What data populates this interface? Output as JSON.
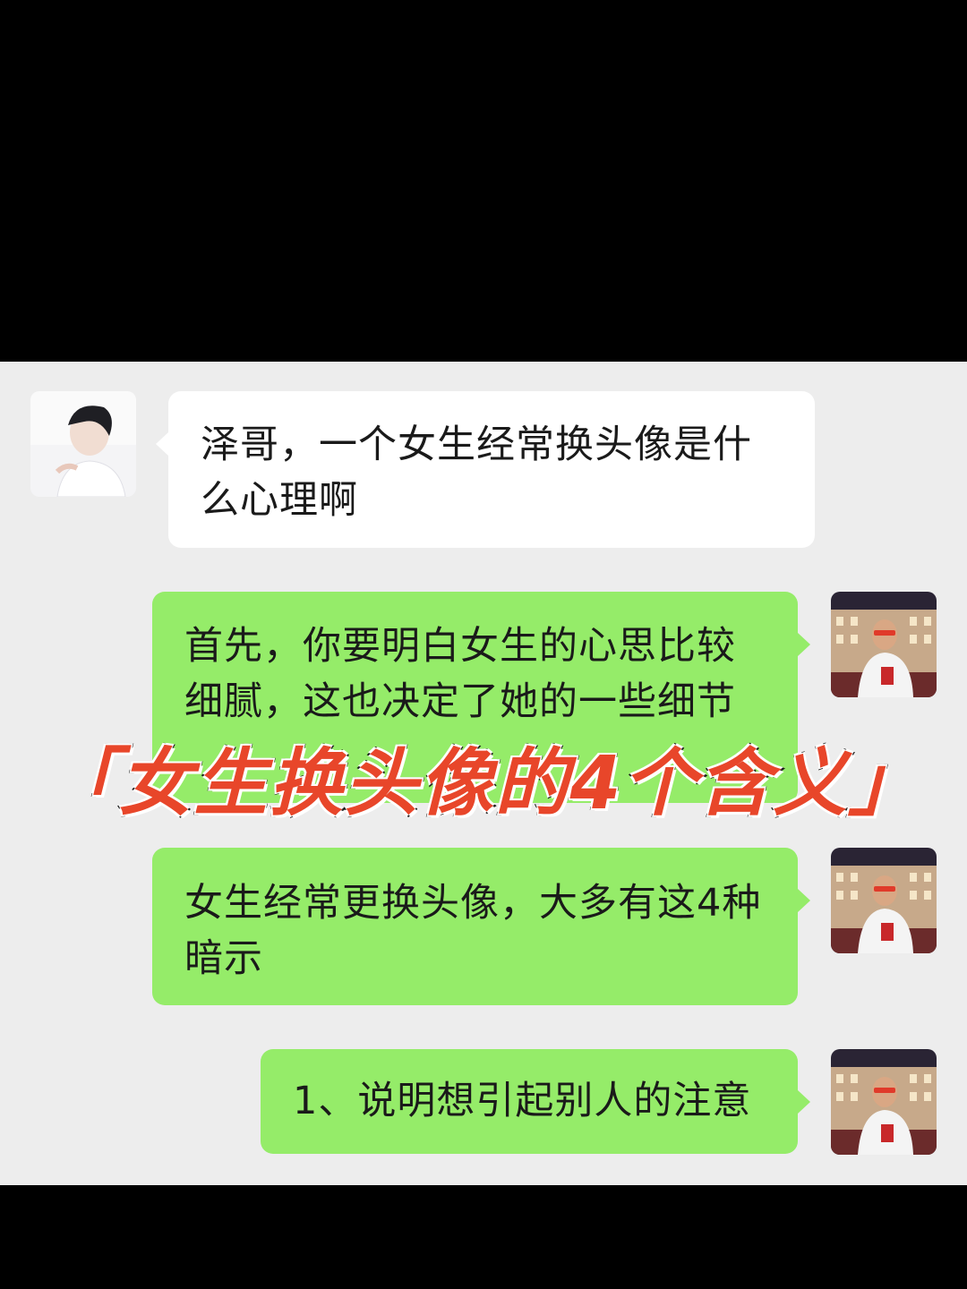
{
  "messages": [
    {
      "side": "left",
      "text": "泽哥，一个女生经常换头像是什么心理啊"
    },
    {
      "side": "right",
      "text": "首先，你要明白女生的心思比较细腻，这也决定了她的一些细节"
    },
    {
      "side": "right",
      "text": "女生经常更换头像，大多有这4种暗示"
    },
    {
      "side": "right",
      "text": "1、说明想引起别人的注意"
    }
  ],
  "overlay_title": "「女生换头像的4个含义」",
  "colors": {
    "chat_bg": "#ededed",
    "incoming_bubble": "#ffffff",
    "outgoing_bubble": "#95ec69",
    "title_fill": "#e8462a"
  }
}
